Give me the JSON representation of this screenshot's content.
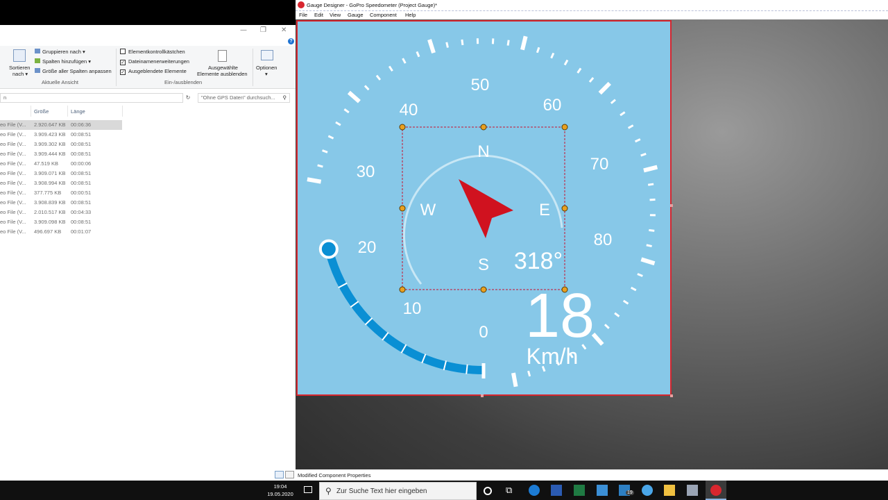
{
  "explorer": {
    "ribbon": {
      "group_by": "Gruppieren nach",
      "add_columns": "Spalten hinzufügen",
      "fit_columns": "Größe aller Spalten anpassen",
      "sort_line1": "Sortieren",
      "sort_line2": "nach",
      "current_view_group": "Aktuelle Ansicht",
      "item_checkboxes": "Elementkontrollkästchen",
      "file_extensions": "Dateinamenerweiterungen",
      "hidden_items": "Ausgeblendete Elemente",
      "hide_selected_line1": "Ausgewählte",
      "hide_selected_line2": "Elemente ausblenden",
      "show_hide_group": "Ein-/ausblenden",
      "options": "Optionen",
      "item_checkboxes_checked": false,
      "file_extensions_checked": true,
      "hidden_items_checked": true
    },
    "address_fragment": "n",
    "search_placeholder": "\"Ohne GPS Daten\" durchsuch...",
    "columns": [
      "Größe",
      "Länge"
    ],
    "rows": [
      {
        "type": "eo File (V...",
        "size": "2.920.647 KB",
        "length": "00:06:36"
      },
      {
        "type": "eo File (V...",
        "size": "3.909.423 KB",
        "length": "00:08:51"
      },
      {
        "type": "eo File (V...",
        "size": "3.909.302 KB",
        "length": "00:08:51"
      },
      {
        "type": "eo File (V...",
        "size": "3.909.444 KB",
        "length": "00:08:51"
      },
      {
        "type": "eo File (V...",
        "size": "47.519 KB",
        "length": "00:00:06"
      },
      {
        "type": "eo File (V...",
        "size": "3.909.071 KB",
        "length": "00:08:51"
      },
      {
        "type": "eo File (V...",
        "size": "3.908.994 KB",
        "length": "00:08:51"
      },
      {
        "type": "eo File (V...",
        "size": "377.775 KB",
        "length": "00:00:51"
      },
      {
        "type": "eo File (V...",
        "size": "3.908.839 KB",
        "length": "00:08:51"
      },
      {
        "type": "eo File (V...",
        "size": "2.010.517 KB",
        "length": "00:04:33"
      },
      {
        "type": "eo File (V...",
        "size": "3.909.098 KB",
        "length": "00:08:51"
      },
      {
        "type": "eo File (V...",
        "size": "496.697 KB",
        "length": "00:01:07"
      }
    ]
  },
  "designer": {
    "title": "Gauge Designer - GoPro Speedometer (Project Gauge)*",
    "menu": [
      "File",
      "Edit",
      "View",
      "Gauge",
      "Component",
      "Help"
    ],
    "status": "Modified Component Properties"
  },
  "gauge": {
    "scale_labels": [
      "0",
      "10",
      "20",
      "30",
      "40",
      "50",
      "60",
      "70",
      "80"
    ],
    "speed": "18",
    "unit": "Km/h",
    "heading": "318°",
    "compass": {
      "north": "N",
      "east": "E",
      "south": "S",
      "west": "W"
    },
    "colors": {
      "background": "#87c8e8",
      "arc": "#0a8fd4",
      "needle": "#d0121f",
      "frame": "#d8262e"
    },
    "speed_fraction_of_scale": 0.225
  },
  "taskbar": {
    "time": "19:04",
    "date": "19.05.2020",
    "search_placeholder": "Zur Suche Text hier eingeben",
    "mail_badge": "19"
  }
}
